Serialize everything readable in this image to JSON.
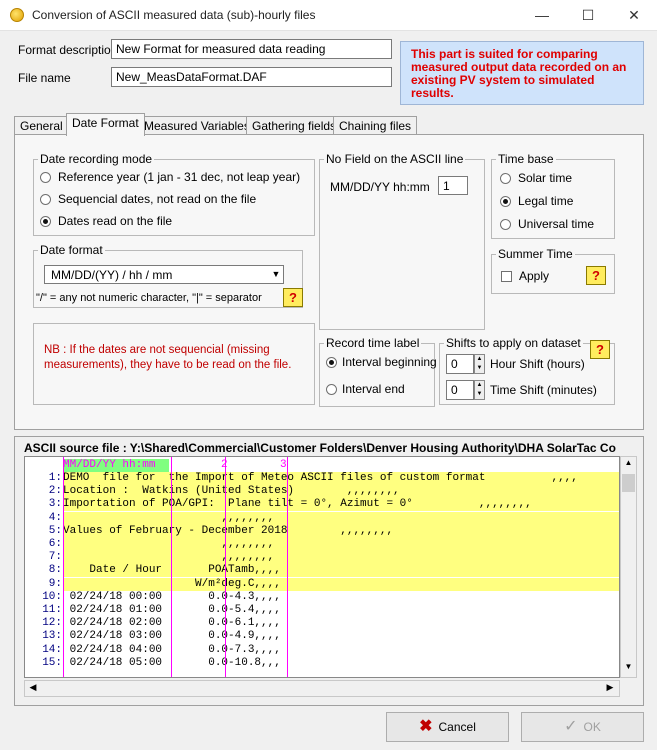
{
  "window": {
    "title": "Conversion of ASCII measured data  (sub)-hourly files",
    "minimize": "—",
    "maximize": "☐",
    "close": "✕"
  },
  "form": {
    "format_description_label": "Format description",
    "format_description_value": "New Format for measured data reading",
    "file_name_label": "File name",
    "file_name_value": "New_MeasDataFormat.DAF"
  },
  "notice": "This part is suited for comparing measured output data recorded on an existing PV system to simulated results.",
  "tabs": [
    "General",
    "Date Format",
    "Measured Variables",
    "Gathering fields",
    "Chaining files"
  ],
  "date_recording_mode": {
    "title": "Date recording mode",
    "options": [
      "Reference year (1 jan - 31 dec, not leap year)",
      "Sequencial dates, not read on the file",
      "Dates read on the file"
    ],
    "selected": 2
  },
  "no_field": {
    "title": "No Field on the ASCII line",
    "format_label": "MM/DD/YY hh:mm",
    "value": "1"
  },
  "time_base": {
    "title": "Time base",
    "options": [
      "Solar time",
      "Legal time",
      "Universal time"
    ],
    "selected": 1
  },
  "summer_time": {
    "title": "Summer Time",
    "apply_label": "Apply"
  },
  "date_format": {
    "title": "Date format",
    "selected": "MM/DD/(YY)  /  hh / mm",
    "hint": "\"/\" = any not numeric character,  \"|\" = separator"
  },
  "nb_note": "NB : If the dates are not sequencial (missing measurements), they have to be read on the file.",
  "record_time_label": {
    "title": "Record time label",
    "options": [
      "Interval beginning",
      "Interval end"
    ],
    "selected": 0
  },
  "shifts": {
    "title": "Shifts to apply on dataset",
    "hour_value": "0",
    "hour_label": "Hour Shift (hours)",
    "time_value": "0",
    "time_label": "Time Shift (minutes)"
  },
  "help_label": "?",
  "source": {
    "title": "ASCII source file : Y:\\Shared\\Commercial\\Customer Folders\\Denver Housing Authority\\DHA SolarTac Co",
    "header_field": "MM/DD/YY hh:mm",
    "header_col2": "2",
    "header_col3": "3",
    "lines": [
      {
        "n": "1:",
        "t": "DEMO  file for  the Import of Meteo ASCII files of custom format          ,,,,",
        "hl": true
      },
      {
        "n": "2:",
        "t": "Location :  Watkins (United States)        ,,,,,,,,",
        "hl": true
      },
      {
        "n": "3:",
        "t": "Importation of POA/GPI:  Plane tilt = 0°, Azimut = 0°          ,,,,,,,,",
        "hl": true
      },
      {
        "n": "4:",
        "t": "                        ,,,,,,,,",
        "hl": true
      },
      {
        "n": "5:",
        "t": "Values of February - December 2018        ,,,,,,,,",
        "hl": true
      },
      {
        "n": "6:",
        "t": "                        ,,,,,,,,",
        "hl": true
      },
      {
        "n": "7:",
        "t": "                        ,,,,,,,,",
        "hl": true
      },
      {
        "n": "8:",
        "t": "    Date / Hour       POATamb,,,,",
        "hl": true
      },
      {
        "n": "9:",
        "t": "                    W/m²deg.C,,,,",
        "hl": true
      },
      {
        "n": "10:",
        "t": " 02/24/18 00:00       0.0-4.3,,,,",
        "hl": false
      },
      {
        "n": "11:",
        "t": " 02/24/18 01:00       0.0-5.4,,,,",
        "hl": false
      },
      {
        "n": "12:",
        "t": " 02/24/18 02:00       0.0-6.1,,,,",
        "hl": false
      },
      {
        "n": "13:",
        "t": " 02/24/18 03:00       0.0-4.9,,,,",
        "hl": false
      },
      {
        "n": "14:",
        "t": " 02/24/18 04:00       0.0-7.3,,,,",
        "hl": false
      },
      {
        "n": "15:",
        "t": " 02/24/18 05:00       0.0-10.8,,,",
        "hl": false
      }
    ]
  },
  "buttons": {
    "cancel": "Cancel",
    "ok": "OK"
  },
  "colors": {
    "highlight": "#ffff80",
    "header_green": "#80ff80",
    "column_marker": "#ff00ff",
    "line_numbers": "#000080"
  }
}
